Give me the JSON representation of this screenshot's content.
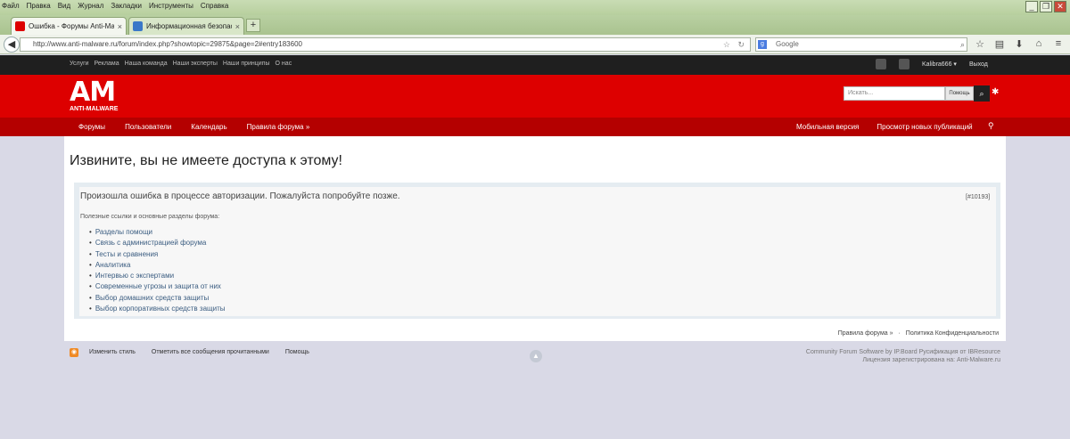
{
  "browser": {
    "menu": [
      "Файл",
      "Правка",
      "Вид",
      "Журнал",
      "Закладки",
      "Инструменты",
      "Справка"
    ],
    "tabs": [
      {
        "title": "Ошибка - Форумы Anti-Malw...",
        "favicon_color": "#dd0000",
        "active": true
      },
      {
        "title": "Информационная безопасно...",
        "favicon_color": "#3a78c8",
        "active": false
      }
    ],
    "new_tab": "+",
    "url": "http://www.anti-malware.ru/forum/index.php?showtopic=29875&page=2#entry183600",
    "search_placeholder": "Google",
    "window_controls": [
      "_",
      "❐",
      "✕"
    ]
  },
  "topbar": {
    "links": [
      "Услуги",
      "Реклама",
      "Наша команда",
      "Наши эксперты",
      "Наши принципы",
      "О нас"
    ],
    "username": "Kalibra666 ▾",
    "logout": "Выход"
  },
  "header": {
    "logo_mark": "AM",
    "logo_text": "ANTI-MALWARE",
    "search_placeholder": "Искать...",
    "search_scope": "Помощь"
  },
  "nav": {
    "left": [
      "Форумы",
      "Пользователи",
      "Календарь",
      "Правила форума »"
    ],
    "right": [
      "Мобильная версия",
      "Просмотр новых публикаций"
    ]
  },
  "main": {
    "heading": "Извините, вы не имеете доступа к этому!",
    "error_message": "Произошла ошибка в процессе авторизации. Пожалуйста попробуйте позже.",
    "error_code": "[#10193]",
    "help_title": "Полезные ссылки и основные разделы форума:",
    "links": [
      "Разделы помощи",
      "Связь с администрацией форума",
      "Тесты и сравнения",
      "Аналитика",
      "Интервью с экспертами",
      "Современные угрозы и защита от них",
      "Выбор домашних средств защиты",
      "Выбор корпоративных средств защиты"
    ]
  },
  "footer": {
    "rules": "Правила форума »",
    "sep": "·",
    "privacy": "Политика Конфиденциальности",
    "bottom_links": [
      "Изменить стиль",
      "Отметить все сообщения прочитанными",
      "Помощь"
    ],
    "credits_line1": "Community Forum Software by IP.Board Русификация от IBResource",
    "credits_line2": "Лицензия зарегистрирована на: Anti-Malware.ru"
  }
}
